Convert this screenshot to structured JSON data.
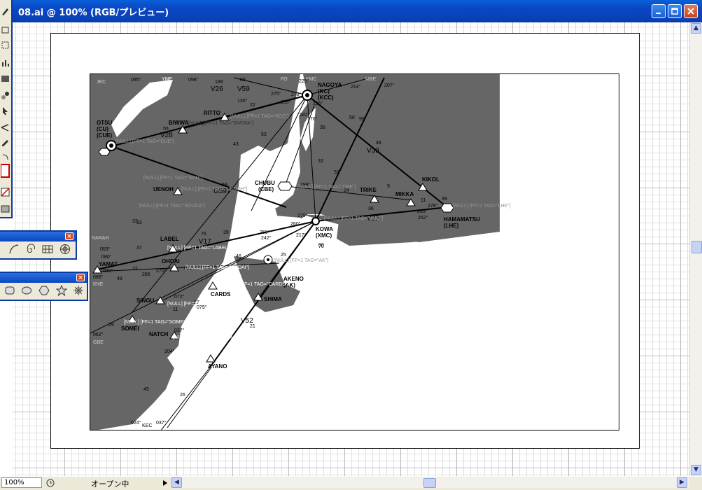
{
  "window": {
    "title": "08.ai @ 100% (RGB/プレビュー)",
    "zoom": "100%",
    "status": "オープン中"
  },
  "toolbox": {
    "tools": [
      "pen-icon",
      "rotate-icon",
      "marquee-icon",
      "graph-icon",
      "gradient-icon",
      "blend-icon",
      "select-icon",
      "width-icon",
      "eyedropper-icon",
      "swap-icon",
      "fill-stroke-icon",
      "none-icon",
      "screen-mode-icon"
    ]
  },
  "palettes": {
    "line_tools": {
      "close_label": "×",
      "tools": [
        "arc-tool-icon",
        "spiral-tool-icon",
        "grid-tool-icon",
        "polar-grid-tool-icon"
      ]
    },
    "shape_tools": {
      "close_label": "×",
      "tools": [
        "rectangle-tool-icon",
        "ellipse-tool-icon",
        "polygon-tool-icon",
        "star-tool-icon",
        "flare-tool-icon"
      ]
    }
  },
  "map": {
    "fixes": [
      {
        "name": "NAGOYA",
        "sub1": "(KC)",
        "sub2": "(KCC)",
        "type": "vortac"
      },
      {
        "name": "OTSU",
        "sub1": "(CU)",
        "sub2": "(CUE)",
        "type": "vortac"
      },
      {
        "name": "CHUBU",
        "sub1": "(CBE)",
        "sub2": "",
        "type": "vor"
      },
      {
        "name": "KOWA",
        "sub1": "(XMC)",
        "sub2": "",
        "type": "vor"
      },
      {
        "name": "HAMAMATSU",
        "sub1": "(LHE)",
        "sub2": "",
        "type": "vor"
      },
      {
        "name": "AKENO",
        "sub1": "(AK)",
        "sub2": "",
        "type": "vor"
      },
      {
        "name": "RITTO",
        "type": "triangle"
      },
      {
        "name": "BIWWA",
        "type": "triangle"
      },
      {
        "name": "UENOH",
        "type": "triangle"
      },
      {
        "name": "LABEL",
        "type": "triangle"
      },
      {
        "name": "OHDAI",
        "type": "triangle"
      },
      {
        "name": "YAMAT",
        "type": "triangle"
      },
      {
        "name": "SINGU",
        "type": "triangle"
      },
      {
        "name": "CARDS",
        "type": "triangle"
      },
      {
        "name": "SHIMA",
        "type": "triangle"
      },
      {
        "name": "SOMEI",
        "type": "triangle"
      },
      {
        "name": "NATCH",
        "type": "triangle"
      },
      {
        "name": "AYANO",
        "type": "triangle"
      },
      {
        "name": "KIKOL",
        "type": "triangle"
      },
      {
        "name": "MIKKA",
        "type": "triangle"
      },
      {
        "name": "TRIKE",
        "type": "triangle"
      }
    ],
    "airways": [
      "V59",
      "V26",
      "V28",
      "V17",
      "V39",
      "V37",
      "V52",
      "G597"
    ],
    "corner_labels": [
      "JEC",
      "YME",
      "FO",
      "KMC",
      "MBE",
      "KNE",
      "GBE",
      "KEC",
      "NARAH"
    ],
    "numbers": [
      "095°",
      "098°",
      "189",
      "89",
      "22",
      "255°",
      "275°",
      "278°",
      "229°",
      "182°",
      "126°",
      "135°",
      "176°",
      "214°",
      "207°",
      "55",
      "11",
      "43",
      "53",
      "59",
      "38",
      "33",
      "52",
      "50",
      "99",
      "48",
      "39",
      "24",
      "9",
      "11",
      "36",
      "265°",
      "278°",
      "252°",
      "279°",
      "260°",
      "250°",
      "242°",
      "298°",
      "70",
      "76",
      "39",
      "37",
      "22",
      "49",
      "266",
      "270°",
      "070°",
      "080°",
      "053°",
      "090°",
      "086°",
      "33",
      "46",
      "25",
      "217°",
      "072°",
      "079°",
      "11",
      "17",
      "21",
      "29",
      "062°",
      "037°",
      "204°",
      "49",
      "037°",
      "024°",
      "26",
      "33",
      "80"
    ],
    "tag_texts": [
      "[NULL] [FF=1 TAG=\"CUE\"]",
      "[NULL] [FF=1 TAG=\"KCC\"]",
      "[NULL] [FF=1 TAG=\"BIWWA\"]",
      "[NULL] [FF=1 TAG=\"SGU\"]",
      "[NULL] [FF=1 TAG=\"UENOH\"]",
      "[NULL] [FF=1 TAG=\"SOUDA\"]",
      "[NULL] [FF=1 TAG=\"CBE\"]",
      "[NULL] [FF=1 TAG=\"LHE\"]",
      "[NULL] [FF=1 TAG=\"XMC\"]",
      "[NULL] [FF=1 TAG=\"LABEL\"]",
      "[NULL] [FF=1 TAG=\"OHDAI\"]",
      "[NULL] [FF=1 TAG=\"AK\"]",
      "[NULL] [FF=1 TAG=\"SINGU\"]",
      "[NULL] [FF=1 TAG=\"SOMEI\"]",
      "[NULL] [FF=1 TAG=\"NATCH\"]",
      "[NULL] [FF=1 TAG=\"CARDS\"]"
    ]
  }
}
